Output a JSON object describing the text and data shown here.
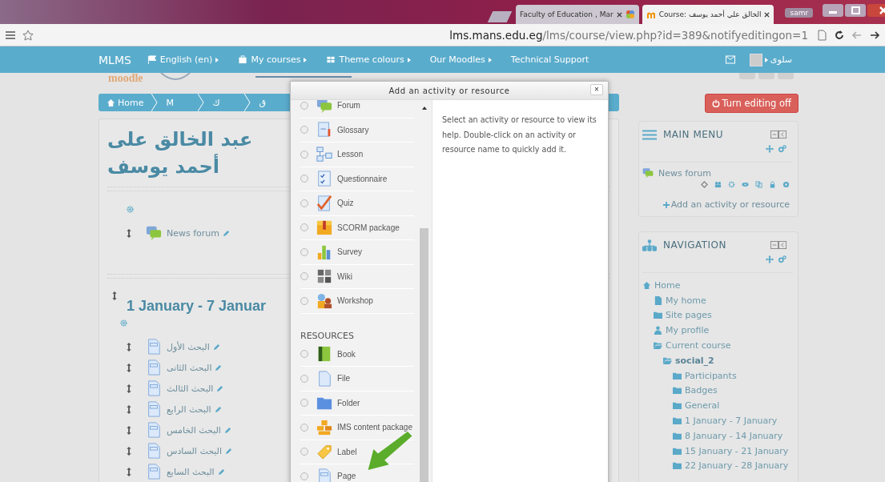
{
  "browser": {
    "tabs": [
      {
        "title": "Faculty of Education , Mar",
        "selected": false
      },
      {
        "title": "Course: الخالق علي أحمد يوسف",
        "selected": true
      }
    ],
    "user": "samr",
    "url_host": "lms.mans.edu.eg",
    "url_path": "/lms/course/view.php?id=389&notifyeditingon=1"
  },
  "navbar": {
    "brand": "MLMS",
    "items": [
      {
        "label": "English (en)",
        "menu": true
      },
      {
        "label": "My courses",
        "menu": true
      },
      {
        "label": "Theme colours",
        "menu": true
      },
      {
        "label": "Our Moodles",
        "menu": true
      },
      {
        "label": "Technical Support",
        "menu": false
      }
    ],
    "user": "سلوى"
  },
  "logo": "moodle",
  "breadcrumb": [
    "Home",
    "M",
    "ك",
    "ق"
  ],
  "course": {
    "title": "عبد الخالق على أحمد يوسف",
    "general_items": [
      "News forum"
    ],
    "section_title": "1 January - 7 Januar",
    "section_items": [
      "البحث الأول",
      "البحث الثانى",
      "البحث الثالث",
      "البحث الرابع",
      "البحث الخامس",
      "البحث السادس",
      "البحث السابع"
    ]
  },
  "dialog": {
    "title": "Add an activity or resource",
    "close": "×",
    "activities": [
      {
        "label": "Forum",
        "selected": false
      },
      {
        "label": "Glossary",
        "selected": false
      },
      {
        "label": "Lesson",
        "selected": false
      },
      {
        "label": "Questionnaire",
        "selected": false
      },
      {
        "label": "Quiz",
        "selected": false
      },
      {
        "label": "SCORM package",
        "selected": false
      },
      {
        "label": "Survey",
        "selected": false
      },
      {
        "label": "Wiki",
        "selected": false
      },
      {
        "label": "Workshop",
        "selected": false
      }
    ],
    "resources_heading": "RESOURCES",
    "resources": [
      {
        "label": "Book",
        "selected": false
      },
      {
        "label": "File",
        "selected": false
      },
      {
        "label": "Folder",
        "selected": false
      },
      {
        "label": "IMS content package",
        "selected": false
      },
      {
        "label": "Label",
        "selected": false
      },
      {
        "label": "Page",
        "selected": false
      }
    ],
    "help": "Select an activity or resource to view its help. Double-click on an activity or resource name to quickly add it."
  },
  "editing_button": "Turn editing off",
  "main_menu": {
    "title": "MAIN MENU",
    "items": [
      "News forum"
    ],
    "add_link": "Add an activity or resource"
  },
  "navigation": {
    "title": "NAVIGATION",
    "tree": [
      {
        "label": "Home",
        "selected": false,
        "children": [
          {
            "label": "My home",
            "selected": false
          },
          {
            "label": "Site pages",
            "selected": false
          },
          {
            "label": "My profile",
            "selected": false
          },
          {
            "label": "Current course",
            "selected": false,
            "children": [
              {
                "label": "social_2",
                "selected": true,
                "children": [
                  {
                    "label": "Participants",
                    "selected": false
                  },
                  {
                    "label": "Badges",
                    "selected": false
                  },
                  {
                    "label": "General",
                    "selected": false
                  },
                  {
                    "label": "1 January - 7 January",
                    "selected": false
                  },
                  {
                    "label": "8 January - 14 January",
                    "selected": false
                  },
                  {
                    "label": "15 January - 21 January",
                    "selected": false
                  },
                  {
                    "label": "22 January - 28 January",
                    "selected": false
                  }
                ]
              }
            ]
          }
        ]
      }
    ]
  }
}
